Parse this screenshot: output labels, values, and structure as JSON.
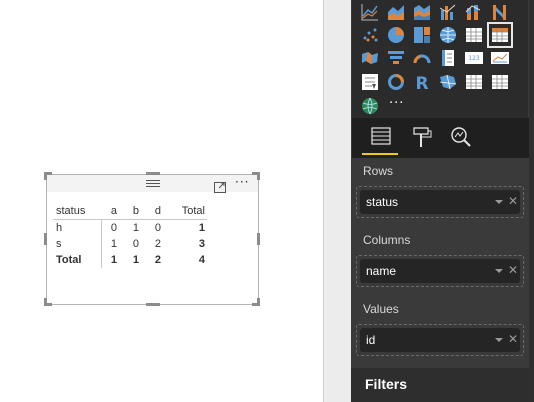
{
  "matrix": {
    "headers": {
      "row_field": "status",
      "columns": [
        "a",
        "b",
        "d"
      ],
      "total": "Total"
    },
    "rows": [
      {
        "label": "h",
        "values": [
          "0",
          "1",
          "0"
        ],
        "total": "1"
      },
      {
        "label": "s",
        "values": [
          "1",
          "0",
          "2"
        ],
        "total": "3"
      }
    ],
    "grand_total": {
      "label": "Total",
      "values": [
        "1",
        "1",
        "2"
      ],
      "total": "4"
    }
  },
  "visualizations_pane": {
    "gallery_icons": [
      "line-chart-icon",
      "area-chart-icon",
      "stacked-area-chart-icon",
      "line-clustered-column-icon",
      "line-stacked-column-icon",
      "ribbon-chart-icon",
      "scatter-chart-icon",
      "pie-chart-icon",
      "treemap-icon",
      "map-icon",
      "table-icon",
      "matrix-icon",
      "filled-map-icon",
      "funnel-icon",
      "gauge-icon",
      "multi-row-card-icon",
      "card-icon",
      "kpi-icon",
      "slicer-icon",
      "donut-chart-icon",
      "r-script-icon",
      "shape-map-icon",
      "custom-table-icon",
      "custom-matrix-icon",
      "globe-icon"
    ],
    "selected_icon": "matrix-icon",
    "more_label": "···",
    "tabs": [
      "fields-tab",
      "format-tab",
      "analytics-tab"
    ],
    "wells": [
      {
        "label": "Rows",
        "field": "status"
      },
      {
        "label": "Columns",
        "field": "name"
      },
      {
        "label": "Values",
        "field": "id"
      }
    ],
    "filters_title": "Filters"
  },
  "colors": {
    "accent": "#f2c811",
    "pane_bg": "#3a3a3a",
    "gallery_bg": "#2b2b2b",
    "blue": "#5b9bd5",
    "orange": "#e0843c"
  }
}
